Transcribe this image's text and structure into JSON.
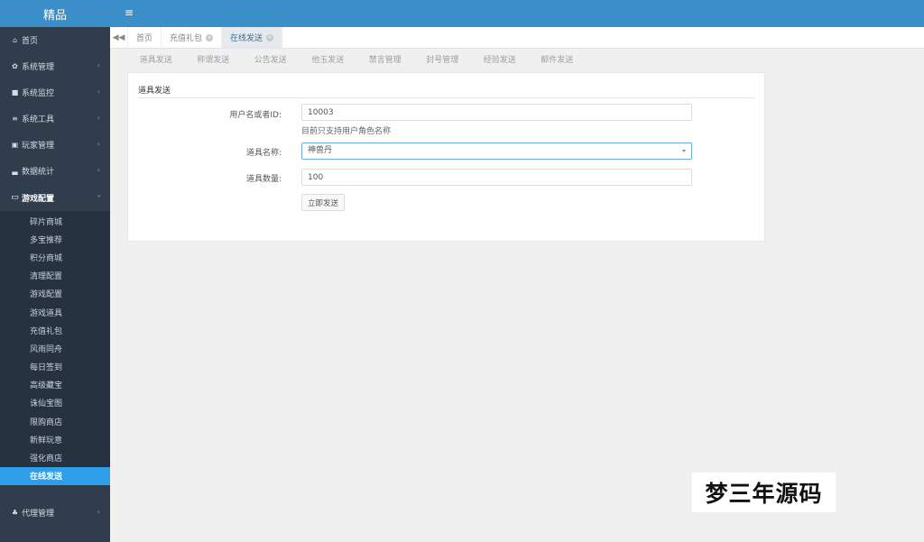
{
  "app": {
    "brand": "精品"
  },
  "sidebar": {
    "items": [
      {
        "label": "首页",
        "icon": "home-icon",
        "glyph": "⌂"
      },
      {
        "label": "系统管理",
        "icon": "gear-icon",
        "glyph": "✿"
      },
      {
        "label": "系统监控",
        "icon": "video-icon",
        "glyph": "■"
      },
      {
        "label": "系统工具",
        "icon": "list-icon",
        "glyph": "≡"
      },
      {
        "label": "玩家管理",
        "icon": "user-card-icon",
        "glyph": "▣"
      },
      {
        "label": "数据统计",
        "icon": "chart-icon",
        "glyph": "▃"
      },
      {
        "label": "游戏配置",
        "icon": "monitor-icon",
        "glyph": "▭"
      }
    ],
    "submenu": [
      "碎片商城",
      "多宝推荐",
      "积分商城",
      "清理配置",
      "游戏配置",
      "游戏道具",
      "充值礼包",
      "风雨同舟",
      "每日签到",
      "高级藏宝",
      "诛仙宝图",
      "限购商店",
      "新鲜玩意",
      "强化商店",
      "在线发送"
    ],
    "agent": {
      "label": "代理管理",
      "icon": "agent-icon",
      "glyph": "♣"
    },
    "chevron": "‹",
    "chevron_open": "›"
  },
  "header": {
    "menu_glyph": "≡"
  },
  "tabs": {
    "back_glyph": "◀◀",
    "items": [
      {
        "label": "首页"
      },
      {
        "label": "充值礼包"
      },
      {
        "label": "在线发送"
      }
    ],
    "close_glyph": "×"
  },
  "functabs": [
    "道具发送",
    "称谓发送",
    "公告发送",
    "他玉发送",
    "禁言管理",
    "封号管理",
    "经验发送",
    "邮件发送"
  ],
  "form": {
    "title": "道具发送",
    "user_label": "用户名或者ID:",
    "user_value": "10003",
    "user_hint": "目前只支持用户角色名称",
    "item_label": "道具名称:",
    "item_value": "神兽丹",
    "qty_label": "道具数量:",
    "qty_value": "100",
    "submit": "立即发送"
  },
  "watermark": "梦三年源码"
}
